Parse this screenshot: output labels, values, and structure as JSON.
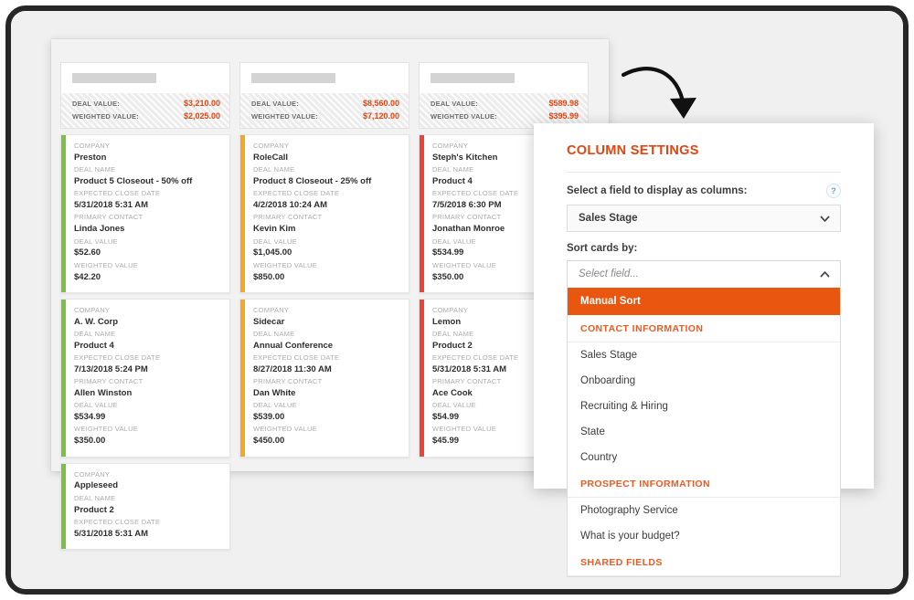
{
  "board": {
    "columns": [
      {
        "title_placeholder": "",
        "accent_color": "#7AC143",
        "totals": [
          {
            "label": "DEAL VALUE:",
            "value": "$3,210.00"
          },
          {
            "label": "WEIGHTED VALUE:",
            "value": "$2,025.00"
          }
        ],
        "cards": [
          {
            "fields": [
              {
                "label": "COMPANY",
                "value": "Preston"
              },
              {
                "label": "DEAL NAME",
                "value": "Product 5 Closeout - 50% off"
              },
              {
                "label": "EXPECTED CLOSE DATE",
                "value": "5/31/2018 5:31 AM"
              },
              {
                "label": "PRIMARY CONTACT",
                "value": "Linda Jones"
              },
              {
                "label": "DEAL VALUE",
                "value": "$52.60"
              },
              {
                "label": "WEIGHTED VALUE",
                "value": "$42.20"
              }
            ]
          },
          {
            "fields": [
              {
                "label": "COMPANY",
                "value": "A. W. Corp"
              },
              {
                "label": "DEAL NAME",
                "value": "Product 4"
              },
              {
                "label": "EXPECTED CLOSE DATE",
                "value": "7/13/2018 5:24 PM"
              },
              {
                "label": "PRIMARY CONTACT",
                "value": "Allen Winston"
              },
              {
                "label": "DEAL VALUE",
                "value": "$534.99"
              },
              {
                "label": "WEIGHTED VALUE",
                "value": "$350.00"
              }
            ]
          },
          {
            "fields": [
              {
                "label": "COMPANY",
                "value": "Appleseed"
              },
              {
                "label": "DEAL NAME",
                "value": "Product 2"
              },
              {
                "label": "EXPECTED CLOSE DATE",
                "value": "5/31/2018 5:31 AM"
              }
            ]
          }
        ]
      },
      {
        "title_placeholder": "",
        "accent_color": "#F5A623",
        "totals": [
          {
            "label": "DEAL VALUE:",
            "value": "$8,560.00"
          },
          {
            "label": "WEIGHTED VALUE:",
            "value": "$7,120.00"
          }
        ],
        "cards": [
          {
            "fields": [
              {
                "label": "COMPANY",
                "value": "RoleCall"
              },
              {
                "label": "DEAL NAME",
                "value": "Product 8 Closeout - 25% off"
              },
              {
                "label": "EXPECTED CLOSE DATE",
                "value": "4/2/2018 10:24 AM"
              },
              {
                "label": "PRIMARY CONTACT",
                "value": "Kevin Kim"
              },
              {
                "label": "DEAL VALUE",
                "value": "$1,045.00"
              },
              {
                "label": "WEIGHTED VALUE",
                "value": "$850.00"
              }
            ]
          },
          {
            "fields": [
              {
                "label": "COMPANY",
                "value": "Sidecar"
              },
              {
                "label": "DEAL NAME",
                "value": "Annual Conference"
              },
              {
                "label": "EXPECTED CLOSE DATE",
                "value": "8/27/2018 11:30 AM"
              },
              {
                "label": "PRIMARY CONTACT",
                "value": "Dan White"
              },
              {
                "label": "DEAL VALUE",
                "value": "$539.00"
              },
              {
                "label": "WEIGHTED VALUE",
                "value": "$450.00"
              }
            ]
          }
        ]
      },
      {
        "title_placeholder": "",
        "accent_color": "#EF4136",
        "totals": [
          {
            "label": "DEAL VALUE:",
            "value": "$589.98"
          },
          {
            "label": "WEIGHTED VALUE:",
            "value": "$395.99"
          }
        ],
        "cards": [
          {
            "fields": [
              {
                "label": "COMPANY",
                "value": "Steph's Kitchen"
              },
              {
                "label": "DEAL NAME",
                "value": "Product 4"
              },
              {
                "label": "EXPECTED CLOSE DATE",
                "value": "7/5/2018 6:30 PM"
              },
              {
                "label": "PRIMARY CONTACT",
                "value": "Jonathan Monroe"
              },
              {
                "label": "DEAL VALUE",
                "value": "$534.99"
              },
              {
                "label": "WEIGHTED VALUE",
                "value": "$350.00"
              }
            ]
          },
          {
            "fields": [
              {
                "label": "COMPANY",
                "value": "Lemon"
              },
              {
                "label": "DEAL NAME",
                "value": "Product 2"
              },
              {
                "label": "EXPECTED CLOSE DATE",
                "value": "5/31/2018 5:31 AM"
              },
              {
                "label": "PRIMARY CONTACT",
                "value": "Ace Cook"
              },
              {
                "label": "DEAL VALUE",
                "value": "$54.99"
              },
              {
                "label": "WEIGHTED VALUE",
                "value": "$45.99"
              }
            ]
          }
        ]
      }
    ]
  },
  "column_settings": {
    "title": "COLUMN SETTINGS",
    "field_label": "Select a field to display as columns:",
    "help_icon_glyph": "?",
    "column_field": {
      "selected": "Sales Stage",
      "chevron": "chevron-down-icon"
    },
    "sort_label": "Sort cards by:",
    "sort_field": {
      "placeholder": "Select field...",
      "chevron": "chevron-up-icon"
    },
    "dropdown_items": [
      {
        "type": "option",
        "label": "Manual Sort",
        "selected": true
      },
      {
        "type": "group",
        "label": "CONTACT INFORMATION"
      },
      {
        "type": "option",
        "label": "Sales Stage",
        "selected": false
      },
      {
        "type": "option",
        "label": "Onboarding",
        "selected": false
      },
      {
        "type": "option",
        "label": "Recruiting & Hiring",
        "selected": false
      },
      {
        "type": "option",
        "label": "State",
        "selected": false
      },
      {
        "type": "option",
        "label": "Country",
        "selected": false
      },
      {
        "type": "group",
        "label": "PROSPECT INFORMATION"
      },
      {
        "type": "option",
        "label": "Photography Service",
        "selected": false
      },
      {
        "type": "option",
        "label": "What is your budget?",
        "selected": false
      },
      {
        "type": "group",
        "label": "SHARED FIELDS"
      }
    ]
  },
  "decorations": {
    "arrow": "curved-arrow-icon"
  },
  "colors": {
    "brand_orange": "#E8430F",
    "dropdown_highlight": "#E8560F",
    "group_heading": "#EF5A22",
    "accent_green": "#7AC143",
    "accent_yellow": "#F5A623",
    "accent_red": "#EF4136",
    "help_blue": "#52A9D8"
  }
}
